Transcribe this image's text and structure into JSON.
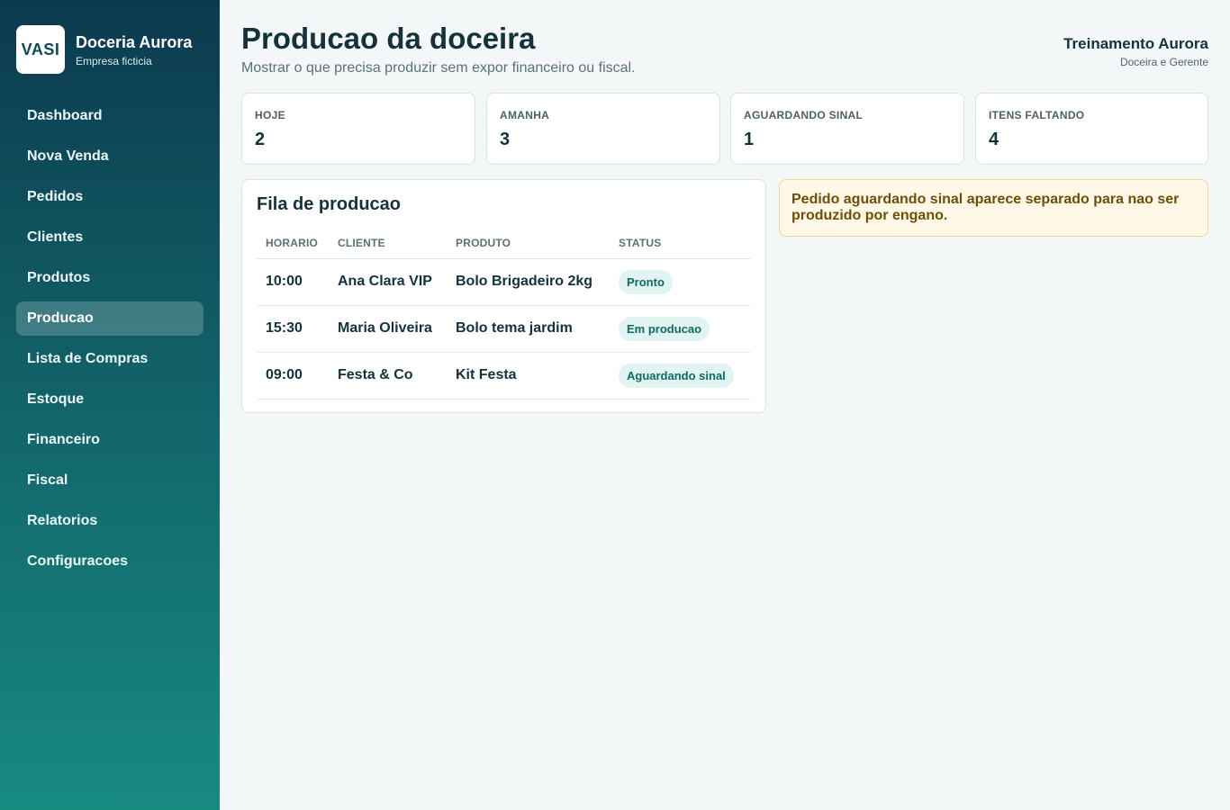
{
  "brand": {
    "logo": "VASI",
    "name": "Doceria Aurora",
    "subtitle": "Empresa ficticia"
  },
  "nav": {
    "items": [
      {
        "label": "Dashboard"
      },
      {
        "label": "Nova Venda"
      },
      {
        "label": "Pedidos"
      },
      {
        "label": "Clientes"
      },
      {
        "label": "Produtos"
      },
      {
        "label": "Producao",
        "active": true
      },
      {
        "label": "Lista de Compras"
      },
      {
        "label": "Estoque"
      },
      {
        "label": "Financeiro"
      },
      {
        "label": "Fiscal"
      },
      {
        "label": "Relatorios"
      },
      {
        "label": "Configuracoes"
      }
    ]
  },
  "header": {
    "title": "Producao da doceira",
    "subtitle": "Mostrar o que precisa produzir sem expor financeiro ou fiscal."
  },
  "user": {
    "name": "Treinamento Aurora",
    "role": "Doceira e Gerente"
  },
  "cards": [
    {
      "label": "HOJE",
      "value": "2"
    },
    {
      "label": "AMANHA",
      "value": "3"
    },
    {
      "label": "AGUARDANDO SINAL",
      "value": "1"
    },
    {
      "label": "ITENS FALTANDO",
      "value": "4"
    }
  ],
  "queue": {
    "title": "Fila de producao",
    "columns": [
      "HORARIO",
      "CLIENTE",
      "PRODUTO",
      "STATUS"
    ],
    "rows": [
      {
        "time": "10:00",
        "client": "Ana Clara VIP",
        "product": "Bolo Brigadeiro 2kg",
        "status": "Pronto"
      },
      {
        "time": "15:30",
        "client": "Maria Oliveira",
        "product": "Bolo tema jardim",
        "status": "Em producao"
      },
      {
        "time": "09:00",
        "client": "Festa & Co",
        "product": "Kit Festa",
        "status": "Aguardando sinal"
      }
    ]
  },
  "alert": {
    "text": "Pedido aguardando sinal aparece separado para nao ser produzido por engano."
  },
  "colors": {
    "sidebar_top": "#0b3a4e",
    "sidebar_bottom": "#178a80",
    "background": "#f3f7f7",
    "badge_bg": "#e2f4f1",
    "badge_text": "#0f6b62",
    "alert_bg": "#fff8e6",
    "alert_text": "#6e4f08"
  }
}
